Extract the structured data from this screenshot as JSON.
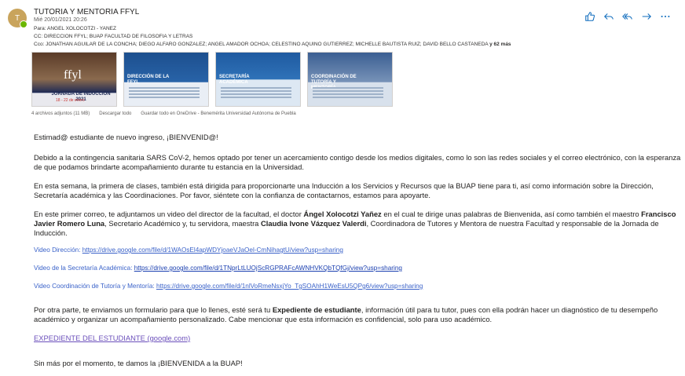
{
  "header": {
    "avatar_initial": "T",
    "sender": "TUTORIA Y MENTORIA FFYL",
    "date": "Mié 20/01/2021 20:26",
    "para": "Para:  ANGEL XOLOCOTZI - YANEZ",
    "cc": "CC:  DIRECCION FFYL; BUAP FACULTAD DE FILOSOFIA Y LETRAS",
    "cco": "Cco:  JONATHAN AGUILAR DE LA CONCHA; DIEGO ALFARO GONZALEZ; ANGEL AMADOR OCHOA; CELESTINO AQUINO GUTIERREZ; MICHELLE BAUTISTA RUIZ; DAVID BELLO CASTANEDA",
    "cco_more": "y 62 más"
  },
  "actions": [
    "like-icon",
    "reply-icon",
    "reply-all-icon",
    "forward-icon",
    "more-icon"
  ],
  "attachments": [
    {
      "title": "JORNADA DE INDUCCIÓN 2021",
      "sub": "18 - 22 de enero",
      "logo": "ffyl"
    },
    {
      "title": "DIRECCIÓN DE LA FFYL"
    },
    {
      "title": "SECRETARÍA ACADÉMICA"
    },
    {
      "title": "COORDINACIÓN DE TUTORÍA Y MENTORÍA"
    }
  ],
  "attachment_meta": {
    "count": "4 archivos adjuntos (11 MB)",
    "download_all": "Descargar todo",
    "save_onedrive": "Guardar todo en OneDrive - Benemérita Universidad Autónoma de Puebla"
  },
  "body": {
    "greeting": "Estimad@ estudiante de nuevo ingreso, ¡BIENVENID@!",
    "p1": "Debido a la contingencia sanitaria SARS CoV-2, hemos optado por tener un acercamiento contigo desde los medios digitales, como lo son las redes sociales y el correo electrónico, con la esperanza de que podamos brindarte acompañamiento durante tu estancia en la Universidad.",
    "p2": "En esta semana, la primera de clases, también está dirigida para proporcionarte una Inducción a los Servicios y Recursos que la BUAP tiene para ti, así como información sobre la Dirección, Secretaría académica y las Coordinaciones. Por favor, siéntete con la confianza de contactarnos, estamos para apoyarte.",
    "p3_a": "En este primer correo, te adjuntamos un video del director de la facultad, el doctor ",
    "p3_b": "Ángel Xolocotzi Yañez",
    "p3_c": " en el cual te dirige unas palabras de Bienvenida, así como también el maestro ",
    "p3_d": "Francisco Javier Romero Luna",
    "p3_e": ", Secretario Académico y, tu servidora, maestra ",
    "p3_f": "Claudia Ivone Vázquez Valerdi",
    "p3_g": ", Coordinadora de Tutores y Mentora de nuestra Facultad y responsable de la Jornada de Inducción.",
    "video1_label": "Video Dirección: ",
    "video1_url": "https://drive.google.com/file/d/1WAOsEl4apWDYjoaeVJaOel-CmNihagtU/view?usp=sharing",
    "video2_label": "Video de la Secretaría Académica: ",
    "video2_url": "https://drive.google.com/file/d/1TNprLtLUOjScRGPRAFcAWNHVKQbTQfGj/view?usp=sharing",
    "video3_label": "Video Coordinación de Tutoría y Mentoría: ",
    "video3_url": "https://drive.google.com/file/d/1nlVoRmeNsxjYo_TgSOAhH1WeEsU5QPg6/view?usp=sharing",
    "p4_a": "Por otra parte, te enviamos un formulario para que lo llenes, esté será tu ",
    "p4_b": "Expediente de estudiante",
    "p4_c": ", información útil para tu tutor, pues con ella podrán hacer un diagnóstico de tu desempeño académico y organizar un acompañamiento personalizado. Cabe mencionar que esta información es confidencial, solo para uso académico.",
    "form_link": "EXPEDIENTE DEL ESTUDIANTE (google.com)",
    "closing": "Sin más por el momento, te damos la ¡BIENVENIDA a la BUAP!"
  },
  "colors": {
    "link": "#3a62c9",
    "accent": "#0f6cbd",
    "avatar": "#c9a45c"
  }
}
